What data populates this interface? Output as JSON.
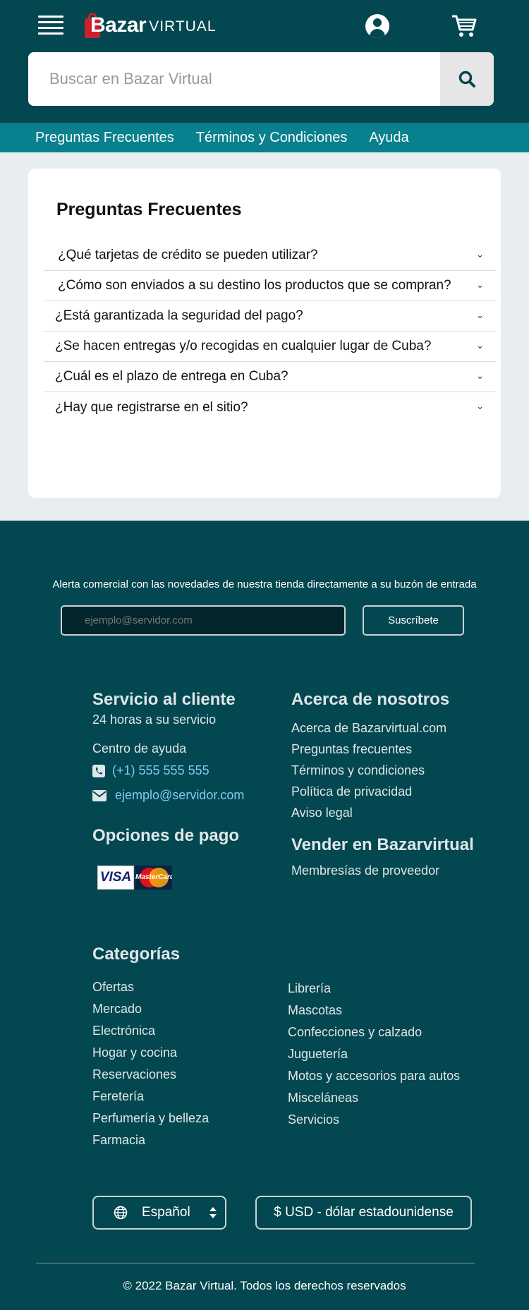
{
  "header": {
    "logo_main": "Bazar",
    "logo_sub": "VIRTUAL",
    "menu_icon": "hamburger-menu-icon",
    "account_icon": "user-account-icon",
    "cart_icon": "shopping-cart-icon",
    "brand_color": "#034750"
  },
  "search": {
    "placeholder": "Buscar en Bazar Virtual",
    "button_icon": "search-icon"
  },
  "subnav": {
    "items": [
      "Preguntas Frecuentes",
      "Términos y Condiciones",
      "Ayuda"
    ],
    "color": "#08808e"
  },
  "faq": {
    "title": "Preguntas Frecuentes",
    "questions": [
      "¿Qué tarjetas de crédito se pueden utilizar?",
      "¿Cómo son enviados a su destino los productos que se compran?",
      "¿Está garantizada la seguridad del pago?",
      "¿Se hacen entregas y/o recogidas en cualquier lugar de Cuba?",
      "¿Cuál es el plazo de entrega en Cuba?",
      "¿Hay que registrarse en el sitio?"
    ]
  },
  "footer": {
    "newsletter_text": "Alerta comercial con las novedades de nuestra tienda directamente a su buzón de entrada",
    "email_placeholder": "ejemplo@servidor.com",
    "subscribe_label": "Suscríbete",
    "customer_service": {
      "title": "Servicio al cliente",
      "subtitle": "24 horas a su servicio",
      "help_center": "Centro de ayuda",
      "phone": "(+1) 555 555 555",
      "email": "ejemplo@servidor.com"
    },
    "payment": {
      "title": "Opciones de pago",
      "visa": "VISA",
      "mastercard": "MasterCard"
    },
    "about": {
      "title": "Acerca de nosotros",
      "links": [
        "Acerca de Bazarvirtual.com",
        "Preguntas frecuentes",
        "Términos y condiciones",
        "Política de privacidad",
        "Aviso legal"
      ]
    },
    "sell": {
      "title": "Vender en Bazarvirtual",
      "links": [
        "Membresías de proveedor"
      ]
    },
    "categories": {
      "title": "Categorías",
      "left": [
        "Ofertas",
        "Mercado",
        "Electrónica",
        "Hogar y cocina",
        "Reservaciones",
        "Feretería",
        "Perfumería y belleza",
        "Farmacia"
      ],
      "right": [
        "Librería",
        "Mascotas",
        "Confecciones y calzado",
        "Juguetería",
        "Motos y accesorios para autos",
        "Misceláneas",
        "Servicios"
      ]
    },
    "language": "Español",
    "currency": "$ USD - dólar estadounidense",
    "copyright": "© 2022  Bazar Virtual. Todos los derechos reservados"
  }
}
